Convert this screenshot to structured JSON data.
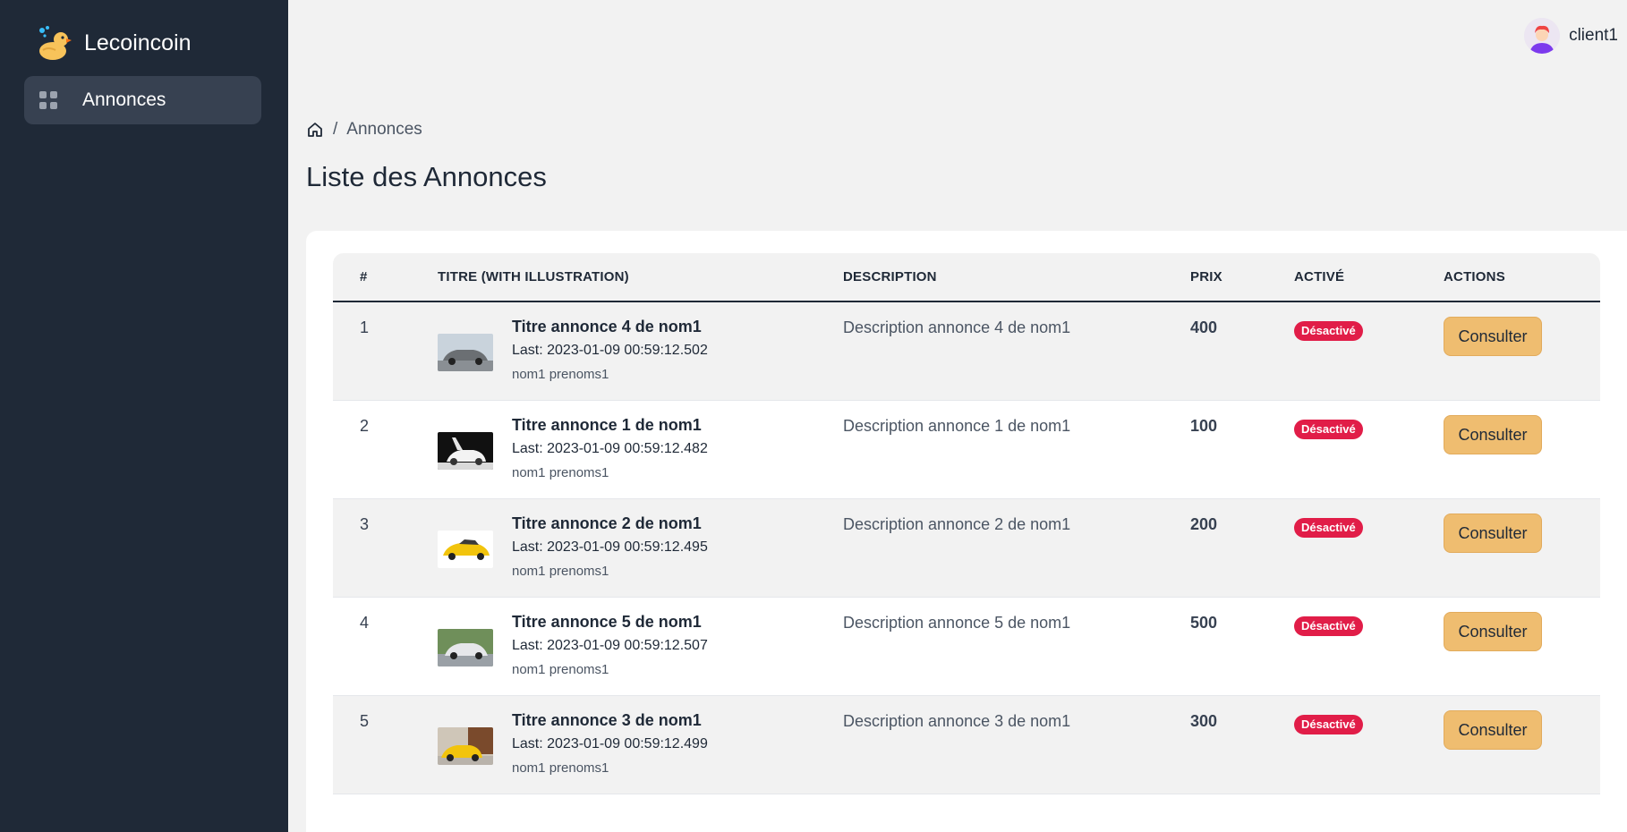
{
  "app": {
    "name": "Lecoincoin"
  },
  "sidebar": {
    "items": [
      {
        "label": "Annonces",
        "icon": "grid-icon"
      }
    ]
  },
  "user": {
    "name": "client1"
  },
  "breadcrumb": {
    "current": "Annonces"
  },
  "page": {
    "title": "Liste des Annonces"
  },
  "colors": {
    "sidebar": "#1f2937",
    "badge": "#e11d48",
    "button": "#efbd70"
  },
  "table": {
    "headers": {
      "num": "#",
      "title": "TITRE (WITH ILLUSTRATION)",
      "description": "DESCRIPTION",
      "price": "PRIX",
      "active": "ACTIVÉ",
      "actions": "ACTIONS"
    },
    "rows": [
      {
        "num": "1",
        "title": "Titre annonce 4 de nom1",
        "last": "Last: 2023-01-09 00:59:12.502",
        "author": "nom1 prenoms1",
        "description": "Description annonce 4 de nom1",
        "price": "400",
        "status": "Désactivé",
        "action": "Consulter"
      },
      {
        "num": "2",
        "title": "Titre annonce 1 de nom1",
        "last": "Last: 2023-01-09 00:59:12.482",
        "author": "nom1 prenoms1",
        "description": "Description annonce 1 de nom1",
        "price": "100",
        "status": "Désactivé",
        "action": "Consulter"
      },
      {
        "num": "3",
        "title": "Titre annonce 2 de nom1",
        "last": "Last: 2023-01-09 00:59:12.495",
        "author": "nom1 prenoms1",
        "description": "Description annonce 2 de nom1",
        "price": "200",
        "status": "Désactivé",
        "action": "Consulter"
      },
      {
        "num": "4",
        "title": "Titre annonce 5 de nom1",
        "last": "Last: 2023-01-09 00:59:12.507",
        "author": "nom1 prenoms1",
        "description": "Description annonce 5 de nom1",
        "price": "500",
        "status": "Désactivé",
        "action": "Consulter"
      },
      {
        "num": "5",
        "title": "Titre annonce 3 de nom1",
        "last": "Last: 2023-01-09 00:59:12.499",
        "author": "nom1 prenoms1",
        "description": "Description annonce 3 de nom1",
        "price": "300",
        "status": "Désactivé",
        "action": "Consulter"
      }
    ]
  }
}
